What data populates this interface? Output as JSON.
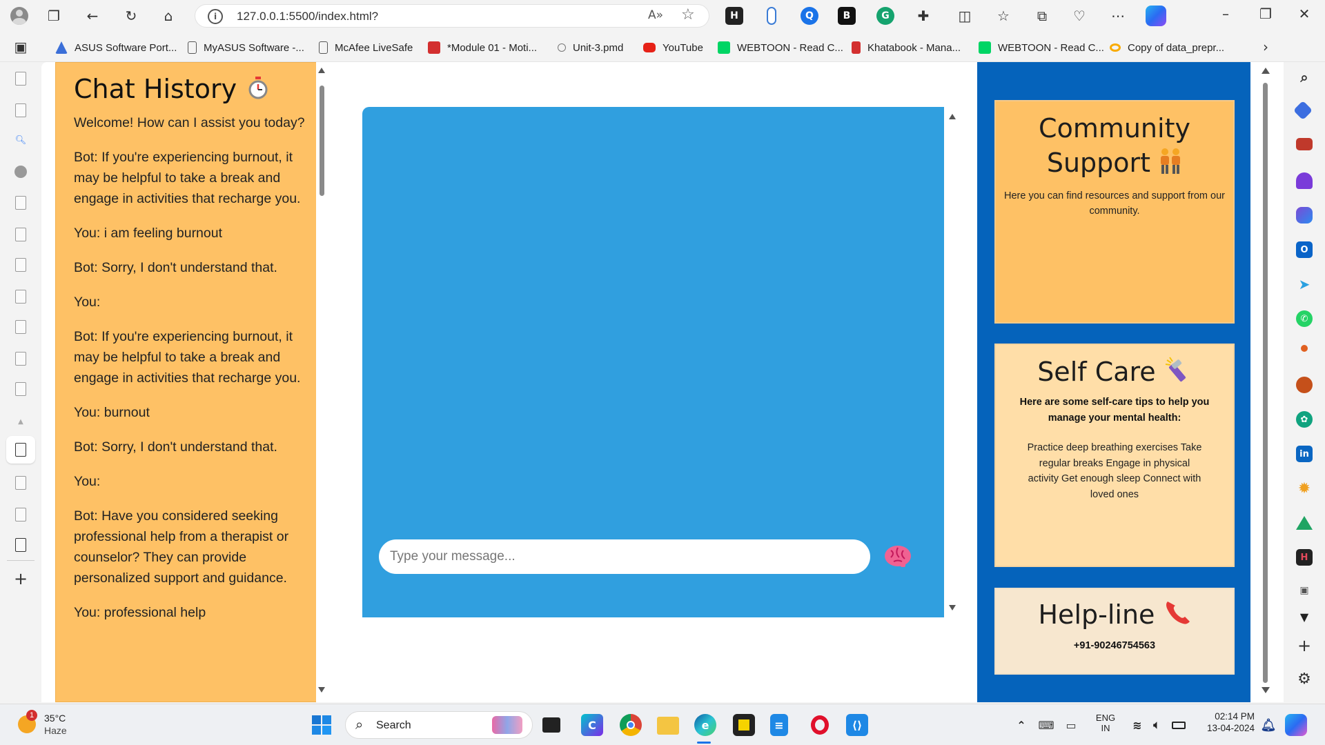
{
  "browser": {
    "url": "127.0.0.1:5500/index.html?",
    "bookmarks": [
      {
        "label": "ASUS Software Port...",
        "color": "#3b6fd8"
      },
      {
        "label": "MyASUS Software -...",
        "color": "#ffffff"
      },
      {
        "label": "McAfee LiveSafe",
        "color": "#ffffff"
      },
      {
        "label": "*Module 01 - Moti...",
        "color": "#d32f2f"
      },
      {
        "label": "Unit-3.pmd",
        "color": "#777777"
      },
      {
        "label": "YouTube",
        "color": "#e62117"
      },
      {
        "label": "WEBTOON - Read C...",
        "color": "#00d564"
      },
      {
        "label": "Khatabook - Mana...",
        "color": "#d32f2f"
      },
      {
        "label": "WEBTOON - Read C...",
        "color": "#00d564"
      },
      {
        "label": "Copy of data_prepr...",
        "color": "#f9ab00"
      }
    ]
  },
  "chat_history": {
    "title": "Chat History",
    "title_icon": "stopwatch-icon",
    "messages": [
      "Welcome! How can I assist you today?",
      "Bot: If you're experiencing burnout, it may be helpful to take a break and engage in activities that recharge you.",
      "You: i am feeling burnout",
      "Bot: Sorry, I don't understand that.",
      "You:",
      "Bot: If you're experiencing burnout, it may be helpful to take a break and engage in activities that recharge you.",
      "You: burnout",
      "Bot: Sorry, I don't understand that.",
      "You:",
      "Bot: Have you considered seeking professional help from a therapist or counselor? They can provide personalized support and guidance.",
      "You: professional help"
    ]
  },
  "chat": {
    "input_placeholder": "Type your message...",
    "send_icon": "brain-icon"
  },
  "cards": {
    "community": {
      "title_line1": "Community",
      "title_line2": "Support",
      "icon": "people-icon",
      "text": "Here you can find resources and support from our community."
    },
    "selfcare": {
      "title": "Self Care",
      "icon": "flashlight-icon",
      "subtitle": "Here are some self-care tips to help you manage your mental health:",
      "tips": "Practice deep breathing exercises Take regular breaks Engage in physical activity Get enough sleep Connect with loved ones"
    },
    "helpline": {
      "title": "Help-line",
      "icon": "phone-icon",
      "number": "+91-90246754563"
    }
  },
  "colors": {
    "chat_history_bg": "#fec165",
    "chat_box_bg": "#309fdf",
    "right_panel_bg": "#0563bb",
    "community_bg": "#fec165",
    "selfcare_bg": "#ffdea8",
    "helpline_bg": "#f7e7cf"
  },
  "taskbar": {
    "weather_temp": "35°C",
    "weather_desc": "Haze",
    "weather_badge": "1",
    "search_label": "Search",
    "lang_line1": "ENG",
    "lang_line2": "IN",
    "time": "02:14 PM",
    "date": "13-04-2024"
  }
}
